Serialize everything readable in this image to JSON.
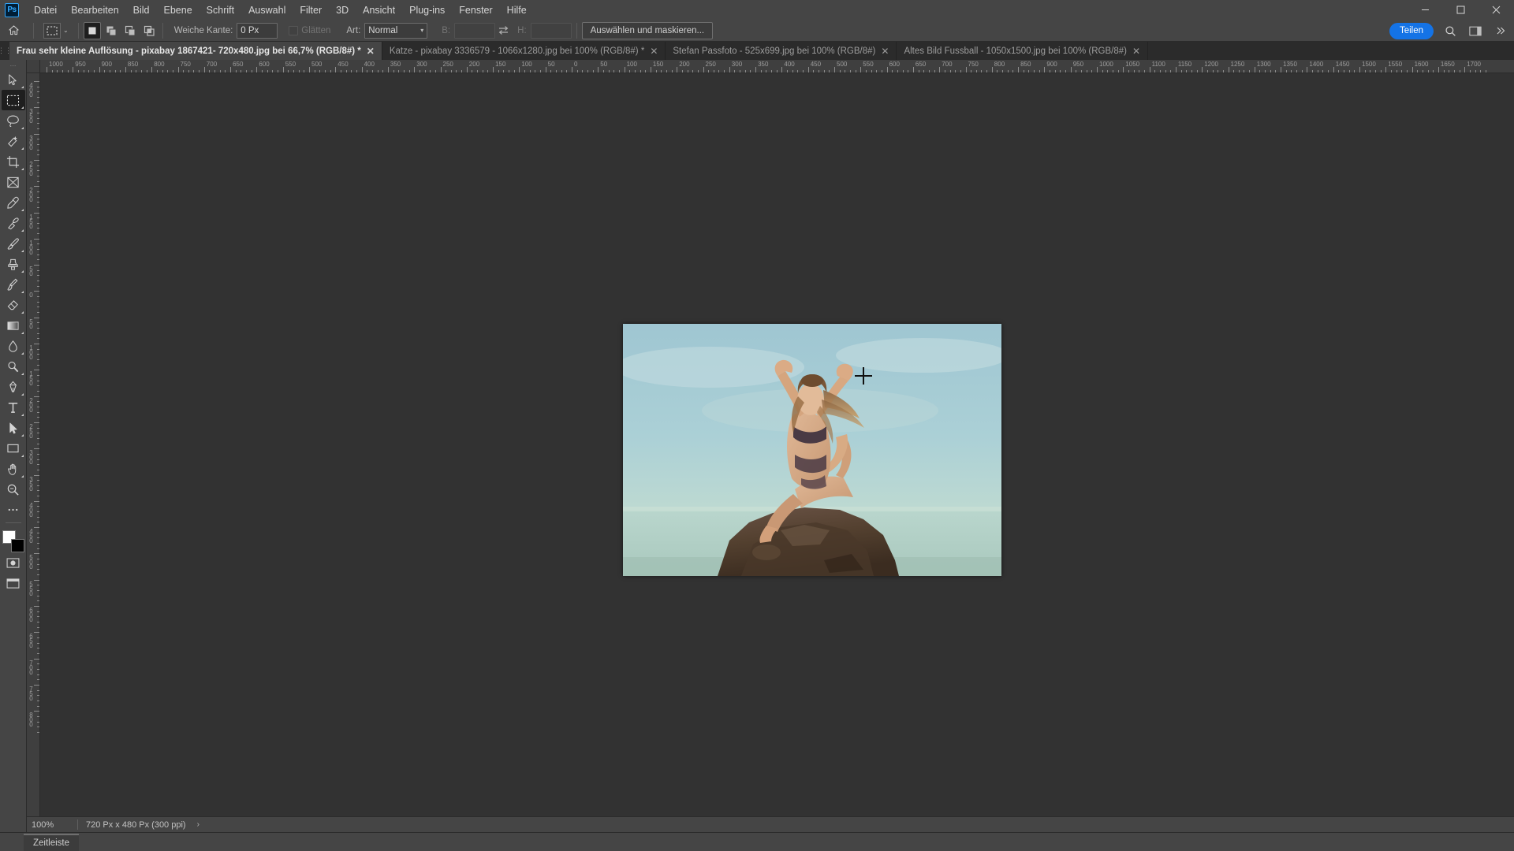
{
  "app": {
    "name": "Adobe Photoshop",
    "logo_text": "Ps",
    "accent_color": "#31a8ff",
    "share_color": "#1473e6"
  },
  "menubar": {
    "items": [
      {
        "label": "Datei"
      },
      {
        "label": "Bearbeiten"
      },
      {
        "label": "Bild"
      },
      {
        "label": "Ebene"
      },
      {
        "label": "Schrift"
      },
      {
        "label": "Auswahl"
      },
      {
        "label": "Filter"
      },
      {
        "label": "3D"
      },
      {
        "label": "Ansicht"
      },
      {
        "label": "Plug-ins"
      },
      {
        "label": "Fenster"
      },
      {
        "label": "Hilfe"
      }
    ],
    "window_controls": {
      "minimize": "─",
      "maximize": "☐",
      "close": "✕"
    }
  },
  "options_bar": {
    "home_icon": "home-icon",
    "tool_icon": "rectangular-marquee-icon",
    "tool_preset_chevron": "⌄",
    "boolean_modes": [
      {
        "name": "new-selection",
        "active": true
      },
      {
        "name": "add-to-selection",
        "active": false
      },
      {
        "name": "subtract-from-selection",
        "active": false
      },
      {
        "name": "intersect-with-selection",
        "active": false
      }
    ],
    "feather_label": "Weiche Kante:",
    "feather_value": "0 Px",
    "antialias_label": "Glätten",
    "antialias_checked": false,
    "style_label": "Art:",
    "style_value": "Normal",
    "width_label": "B:",
    "width_value": "",
    "height_label": "H:",
    "height_value": "",
    "swap_icon": "swap-arrows-icon",
    "select_mask_button": "Auswählen und maskieren...",
    "share_button": "Teilen",
    "search_icon": "search-icon",
    "workspace_icon": "workspace-switcher-icon",
    "more_icon": "chevron-double-right-icon"
  },
  "tabs": [
    {
      "label": "Frau sehr kleine Auflösung - pixabay 1867421- 720x480.jpg bei 66,7% (RGB/8#) *",
      "active": true,
      "close": "✕"
    },
    {
      "label": "Katze - pixabay 3336579 - 1066x1280.jpg bei 100% (RGB/8#) *",
      "active": false,
      "close": "✕"
    },
    {
      "label": "Stefan Passfoto - 525x699.jpg bei 100% (RGB/8#)",
      "active": false,
      "close": "✕"
    },
    {
      "label": "Altes Bild Fussball - 1050x1500.jpg bei 100% (RGB/8#)",
      "active": false,
      "close": "✕"
    }
  ],
  "toolbar": {
    "tools": [
      {
        "name": "move-tool",
        "active": false
      },
      {
        "name": "rectangular-marquee-tool",
        "active": true
      },
      {
        "name": "lasso-tool",
        "active": false
      },
      {
        "name": "quick-selection-tool",
        "active": false
      },
      {
        "name": "crop-tool",
        "active": false
      },
      {
        "name": "frame-tool",
        "active": false
      },
      {
        "name": "eyedropper-tool",
        "active": false
      },
      {
        "name": "spot-healing-brush-tool",
        "active": false
      },
      {
        "name": "brush-tool",
        "active": false
      },
      {
        "name": "clone-stamp-tool",
        "active": false
      },
      {
        "name": "history-brush-tool",
        "active": false
      },
      {
        "name": "eraser-tool",
        "active": false
      },
      {
        "name": "gradient-tool",
        "active": false
      },
      {
        "name": "blur-tool",
        "active": false
      },
      {
        "name": "dodge-tool",
        "active": false
      },
      {
        "name": "pen-tool",
        "active": false
      },
      {
        "name": "type-tool",
        "active": false
      },
      {
        "name": "path-selection-tool",
        "active": false
      },
      {
        "name": "rectangle-tool",
        "active": false
      },
      {
        "name": "hand-tool",
        "active": false
      },
      {
        "name": "zoom-tool",
        "active": false
      },
      {
        "name": "edit-toolbar-tool",
        "active": false
      }
    ],
    "foreground_color": "#ffffff",
    "background_color": "#000000",
    "quick_mask_name": "quick-mask-icon",
    "screen_mode_name": "screen-mode-icon"
  },
  "rulers": {
    "unit": "px",
    "horizontal_labels": [
      "1000",
      "950",
      "900",
      "850",
      "800",
      "750",
      "700",
      "650",
      "600",
      "550",
      "500",
      "450",
      "400",
      "350",
      "300",
      "250",
      "200",
      "150",
      "100",
      "50",
      "0",
      "50",
      "100",
      "150",
      "200",
      "250",
      "300",
      "350",
      "400",
      "450",
      "500",
      "550",
      "600",
      "650",
      "700",
      "750",
      "800",
      "850",
      "900",
      "950",
      "1000",
      "1050",
      "1100",
      "1150",
      "1200",
      "1250",
      "1300",
      "1350",
      "1400",
      "1450",
      "1500",
      "1550",
      "1600",
      "1650",
      "1700"
    ],
    "vertical_labels": [
      "400",
      "350",
      "300",
      "250",
      "200",
      "150",
      "100",
      "50",
      "0",
      "50",
      "100",
      "150",
      "200",
      "250",
      "300",
      "350",
      "400",
      "450",
      "500",
      "550",
      "600",
      "650",
      "700",
      "750",
      "800"
    ]
  },
  "canvas": {
    "document_name": "Frau sehr kleine Auflösung - pixabay 1867421- 720x480.jpg",
    "cursor": "crosshair-cursor"
  },
  "statusbar": {
    "zoom": "100%",
    "doc_info": "720 Px x 480 Px (300 ppi)",
    "expand_arrow": "›"
  },
  "timeline": {
    "tab_label": "Zeitleiste"
  }
}
